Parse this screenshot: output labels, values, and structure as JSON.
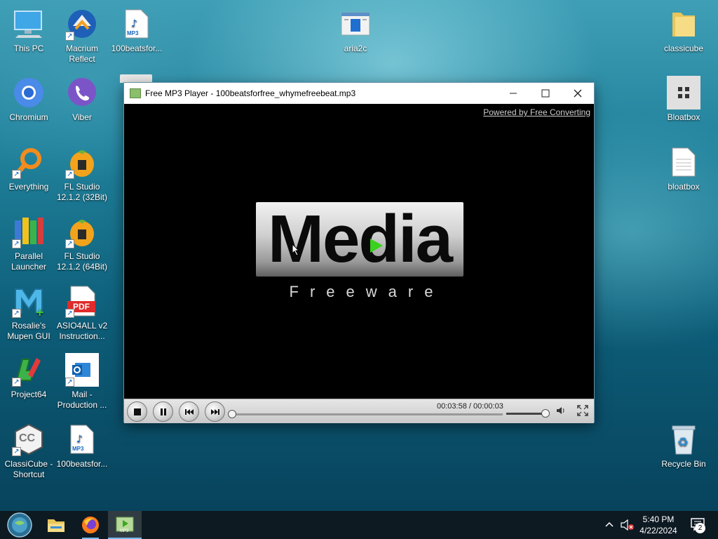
{
  "desktop": {
    "icons": [
      {
        "id": "this-pc",
        "label": "This PC"
      },
      {
        "id": "macrium",
        "label": "Macrium\nReflect"
      },
      {
        "id": "beats1",
        "label": "100beatsfor...",
        "badge": "MP3"
      },
      {
        "id": "aria2c",
        "label": "aria2c"
      },
      {
        "id": "classicube-folder",
        "label": "classicube"
      },
      {
        "id": "chromium",
        "label": "Chromium"
      },
      {
        "id": "viber",
        "label": "Viber"
      },
      {
        "id": "bloatbox-app",
        "label": "Bloatbox"
      },
      {
        "id": "everything",
        "label": "Everything"
      },
      {
        "id": "fl32",
        "label": "FL Studio\n12.1.2 (32Bit)"
      },
      {
        "id": "bloatbox-file",
        "label": "bloatbox"
      },
      {
        "id": "parallel",
        "label": "Parallel\nLauncher"
      },
      {
        "id": "fl64",
        "label": "FL Studio\n12.1.2 (64Bit)"
      },
      {
        "id": "rosalie",
        "label": "Rosalie's\nMupen GUI"
      },
      {
        "id": "asio",
        "label": "ASIO4ALL v2\nInstruction...",
        "badge": "PDF"
      },
      {
        "id": "project64",
        "label": "Project64"
      },
      {
        "id": "mail",
        "label": "Mail -\nProduction ..."
      },
      {
        "id": "classicube-shortcut",
        "label": "ClassiCube -\nShortcut",
        "badge": "CC"
      },
      {
        "id": "beats2",
        "label": "100beatsfor...",
        "badge": "MP3"
      },
      {
        "id": "recycle",
        "label": "Recycle Bin"
      }
    ]
  },
  "window": {
    "title": "Free MP3 Player - 100beatsforfree_whymefreebeat.mp3",
    "powered_by": "Powered by Free Converting",
    "logo_main": "Media",
    "logo_sub": "Freeware",
    "time": "00:03:58 / 00:00:03",
    "seek_fraction": 0.0,
    "volume_fraction": 1.0
  },
  "taskbar": {
    "time": "5:40 PM",
    "date": "4/22/2024",
    "notifications": "2",
    "mp3_badge": "MP3"
  },
  "colors": {
    "accent": "#76b9ed",
    "logo_play": "#39d21c"
  }
}
